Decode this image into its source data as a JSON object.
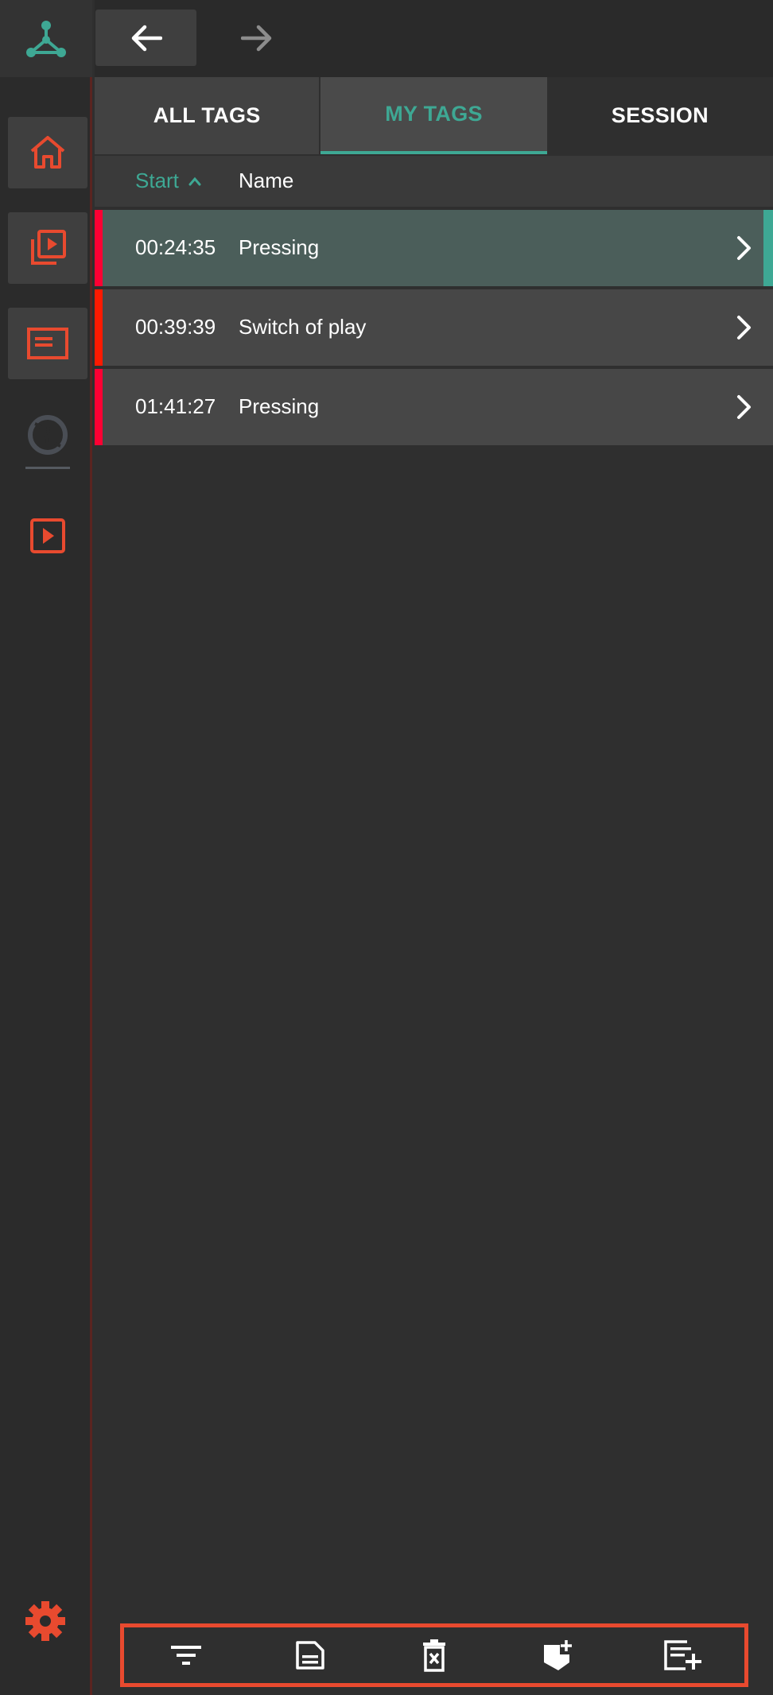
{
  "sidebar": {
    "items": [
      {
        "icon": "home-icon"
      },
      {
        "icon": "video-library-icon"
      },
      {
        "icon": "panel-icon"
      },
      {
        "icon": "aperture-icon"
      },
      {
        "icon": "play-box-icon"
      }
    ],
    "settings_icon": "gear-icon"
  },
  "tabs": [
    {
      "label": "ALL TAGS"
    },
    {
      "label": "MY TAGS"
    },
    {
      "label": "SESSION"
    }
  ],
  "columns": {
    "start": "Start",
    "name": "Name"
  },
  "tags": [
    {
      "time": "00:24:35",
      "name": "Pressing"
    },
    {
      "time": "00:39:39",
      "name": "Switch of play"
    },
    {
      "time": "01:41:27",
      "name": "Pressing"
    }
  ],
  "toolbar": {
    "items": [
      "filter-icon",
      "document-icon",
      "delete-icon",
      "add-tag-icon",
      "add-list-icon"
    ]
  },
  "colors": {
    "accent": "#3ea894",
    "brand": "#e84a2f",
    "marker": "#ff0033"
  }
}
